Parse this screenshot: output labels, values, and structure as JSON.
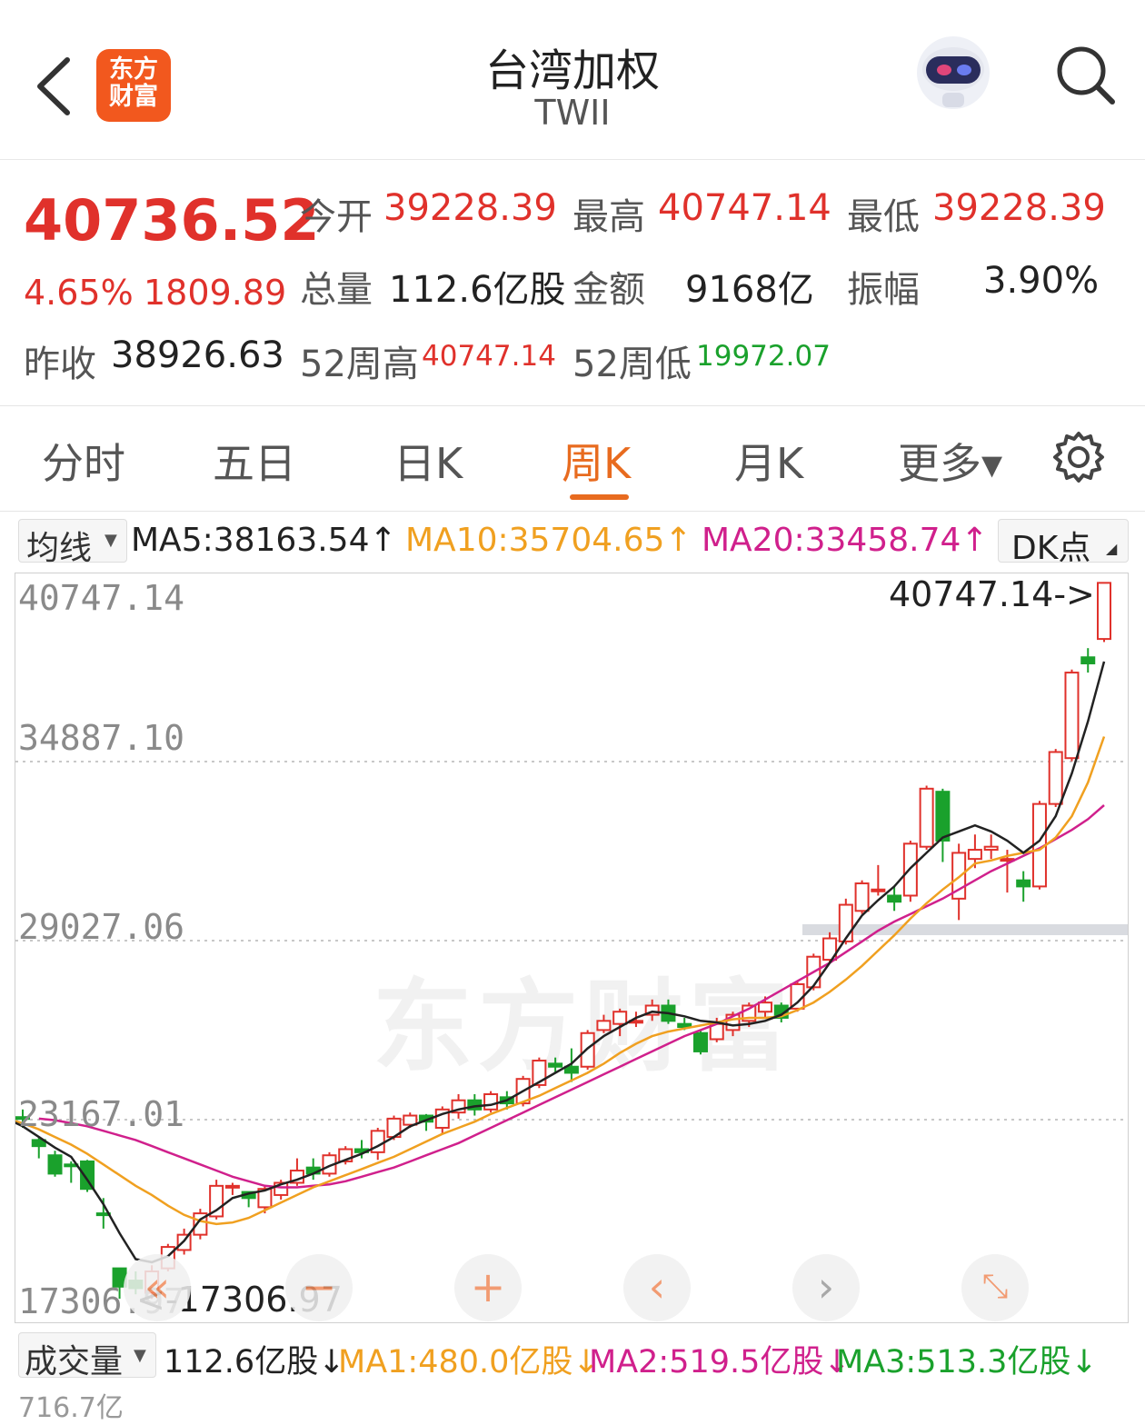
{
  "header": {
    "logo_line1": "东方",
    "logo_line2": "财富",
    "title": "台湾加权",
    "subtitle": "TWII"
  },
  "quote": {
    "price": "40736.52",
    "change_pct": "4.65%",
    "change": "1809.89",
    "open_label": "今开",
    "open": "39228.39",
    "high_label": "最高",
    "high": "40747.14",
    "low_label": "最低",
    "low": "39228.39",
    "volume_label": "总量",
    "volume": "112.6亿股",
    "amount_label": "金额",
    "amount": "9168亿",
    "amplitude_label": "振幅",
    "amplitude": "3.90%",
    "prev_close_label": "昨收",
    "prev_close": "38926.63",
    "high52_label": "52周高",
    "high52": "40747.14",
    "low52_label": "52周低",
    "low52": "19972.07"
  },
  "tabs": [
    {
      "label": "分时",
      "active": false
    },
    {
      "label": "五日",
      "active": false
    },
    {
      "label": "日K",
      "active": false
    },
    {
      "label": "周K",
      "active": true
    },
    {
      "label": "月K",
      "active": false
    },
    {
      "label": "更多▾",
      "active": false
    }
  ],
  "ma_bar": {
    "mode": "均线",
    "ma5": "MA5:38163.54↑",
    "ma10": "MA10:35704.65↑",
    "ma20": "MA20:33458.74↑",
    "dk": "DK点"
  },
  "colors": {
    "up": "#e0312b",
    "down": "#1aa12c",
    "ma5": "#222222",
    "ma10": "#f0a020",
    "ma20": "#d0208c",
    "accent": "#e86b1f"
  },
  "chart_data": {
    "type": "candlestick",
    "y_labels": [
      "40747.14",
      "34887.10",
      "29027.06",
      "23167.01",
      "17306.97"
    ],
    "ylim": [
      17306.97,
      40747.14
    ],
    "max_marker": "40747.14->",
    "min_marker": "<-17306.97",
    "candles": [
      [
        23250,
        23200,
        23500,
        22900
      ],
      [
        22500,
        22300,
        22600,
        21900
      ],
      [
        22000,
        21400,
        22150,
        21300
      ],
      [
        21700,
        21650,
        21800,
        21100
      ],
      [
        21800,
        20900,
        21850,
        20800
      ],
      [
        20100,
        20050,
        20600,
        19600
      ],
      [
        18300,
        17700,
        18300,
        17306.97
      ],
      [
        17900,
        17650,
        18200,
        17450
      ],
      [
        17500,
        18200,
        18400,
        17300
      ],
      [
        18300,
        19000,
        19100,
        18200
      ],
      [
        18900,
        19400,
        19600,
        18750
      ],
      [
        19400,
        20100,
        20250,
        19250
      ],
      [
        20000,
        21000,
        21200,
        19900
      ],
      [
        21000,
        21000,
        21100,
        20700
      ],
      [
        20800,
        20600,
        20800,
        20300
      ],
      [
        20300,
        20900,
        21000,
        20100
      ],
      [
        20700,
        21100,
        21200,
        20550
      ],
      [
        21100,
        21500,
        21900,
        21000
      ],
      [
        21600,
        21400,
        21900,
        21200
      ],
      [
        21400,
        22000,
        22100,
        21300
      ],
      [
        21800,
        22200,
        22300,
        21700
      ],
      [
        22200,
        22100,
        22500,
        21900
      ],
      [
        22100,
        22800,
        22900,
        21850
      ],
      [
        22600,
        23200,
        23300,
        22500
      ],
      [
        23000,
        23300,
        23400,
        22900
      ],
      [
        23300,
        23100,
        23350,
        22800
      ],
      [
        22900,
        23500,
        23600,
        22700
      ],
      [
        23400,
        23800,
        24000,
        23200
      ],
      [
        23800,
        23500,
        24000,
        23300
      ],
      [
        23500,
        24000,
        24100,
        23400
      ],
      [
        23900,
        23700,
        24100,
        23500
      ],
      [
        23700,
        24500,
        24600,
        23600
      ],
      [
        24300,
        25100,
        25200,
        24200
      ],
      [
        25000,
        24900,
        25200,
        24700
      ],
      [
        24900,
        24700,
        25500,
        24400
      ],
      [
        24900,
        26000,
        26100,
        24800
      ],
      [
        26100,
        26400,
        26600,
        26000
      ],
      [
        26300,
        26700,
        26800,
        25900
      ],
      [
        26400,
        26400,
        26700,
        26200
      ],
      [
        26600,
        26900,
        27100,
        26400
      ],
      [
        26900,
        26400,
        27100,
        26300
      ],
      [
        26300,
        26200,
        26500,
        26100
      ],
      [
        26000,
        25400,
        26100,
        25300
      ],
      [
        25800,
        26300,
        26500,
        25700
      ],
      [
        26100,
        26600,
        26700,
        25900
      ],
      [
        26400,
        26900,
        27000,
        26200
      ],
      [
        26700,
        27000,
        27200,
        26500
      ],
      [
        26900,
        26500,
        27000,
        26350
      ],
      [
        26800,
        27600,
        27700,
        26700
      ],
      [
        27500,
        28500,
        28600,
        27400
      ],
      [
        28400,
        29100,
        29300,
        28300
      ],
      [
        29000,
        30200,
        30400,
        28900
      ],
      [
        30000,
        30900,
        31000,
        29900
      ],
      [
        30700,
        30700,
        31500,
        30500
      ],
      [
        30500,
        30300,
        30800,
        30000
      ],
      [
        30500,
        32200,
        32300,
        30300
      ],
      [
        32100,
        34000,
        34100,
        32000
      ],
      [
        33900,
        32300,
        34000,
        31600
      ],
      [
        30400,
        31900,
        32200,
        29700
      ],
      [
        31700,
        32000,
        32500,
        31400
      ],
      [
        32000,
        32100,
        32500,
        31700
      ],
      [
        31700,
        31700,
        32000,
        30600
      ],
      [
        31000,
        30800,
        31300,
        30300
      ],
      [
        30800,
        33500,
        33600,
        30700
      ],
      [
        33500,
        35200,
        35300,
        33400
      ],
      [
        35000,
        37800,
        37900,
        34900
      ],
      [
        38300,
        38100,
        38600,
        37800
      ],
      [
        38900,
        40736.52,
        40747.14,
        38800
      ]
    ],
    "ma5": [
      23200,
      22950,
      22600,
      22250,
      21950,
      21200,
      20400,
      19450,
      18600,
      18500,
      18700,
      19200,
      19900,
      20200,
      20600,
      20750,
      20850,
      21050,
      21200,
      21400,
      21650,
      21850,
      22050,
      22300,
      22600,
      22950,
      23150,
      23350,
      23500,
      23600,
      23650,
      23800,
      24100,
      24400,
      24700,
      25000,
      25500,
      25900,
      26200,
      26500,
      26700,
      26650,
      26550,
      26400,
      26350,
      26250,
      26300,
      26400,
      26600,
      27000,
      27550,
      28300,
      29100,
      29850,
      30350,
      30800,
      31400,
      31900,
      32400,
      32600,
      32800,
      32600,
      32300,
      31900,
      32300,
      33100,
      34500,
      36200,
      38163.54
    ],
    "ma10": [
      23200,
      23050,
      22850,
      22600,
      22350,
      22050,
      21700,
      21350,
      21000,
      20700,
      20350,
      20050,
      19850,
      19750,
      19800,
      19950,
      20200,
      20450,
      20700,
      20950,
      21150,
      21350,
      21550,
      21750,
      21950,
      22200,
      22450,
      22700,
      22900,
      23100,
      23350,
      23550,
      23750,
      23950,
      24200,
      24450,
      24700,
      25000,
      25350,
      25650,
      25900,
      26050,
      26150,
      26250,
      26350,
      26450,
      26500,
      26500,
      26550,
      26750,
      27000,
      27350,
      27750,
      28200,
      28700,
      29200,
      29750,
      30250,
      30700,
      31100,
      31550,
      31650,
      31800,
      31900,
      32000,
      32400,
      33100,
      34200,
      35704.65
    ],
    "ma20": [
      23200,
      23150,
      23050,
      22950,
      22800,
      22650,
      22500,
      22300,
      22100,
      21900,
      21700,
      21500,
      21300,
      21150,
      21000,
      20950,
      20950,
      21000,
      21050,
      21150,
      21300,
      21450,
      21600,
      21800,
      22000,
      22200,
      22400,
      22650,
      22900,
      23150,
      23400,
      23650,
      23900,
      24150,
      24400,
      24650,
      24900,
      25150,
      25400,
      25650,
      25900,
      26100,
      26300,
      26550,
      26800,
      27100,
      27400,
      27700,
      28000,
      28300,
      28650,
      29000,
      29350,
      29650,
      29900,
      30150,
      30400,
      30700,
      31000,
      31300,
      31550,
      31800,
      32050,
      32350,
      32650,
      33000,
      33458.74
    ]
  },
  "watermark": "东方财富",
  "volume_bar": {
    "mode": "成交量",
    "volume": "112.6亿股↓",
    "ma1": "MA1:480.0亿股↓",
    "ma2": "MA2:519.5亿股↓",
    "ma3": "MA3:513.3亿股↓",
    "partial_label": "716.7亿"
  }
}
